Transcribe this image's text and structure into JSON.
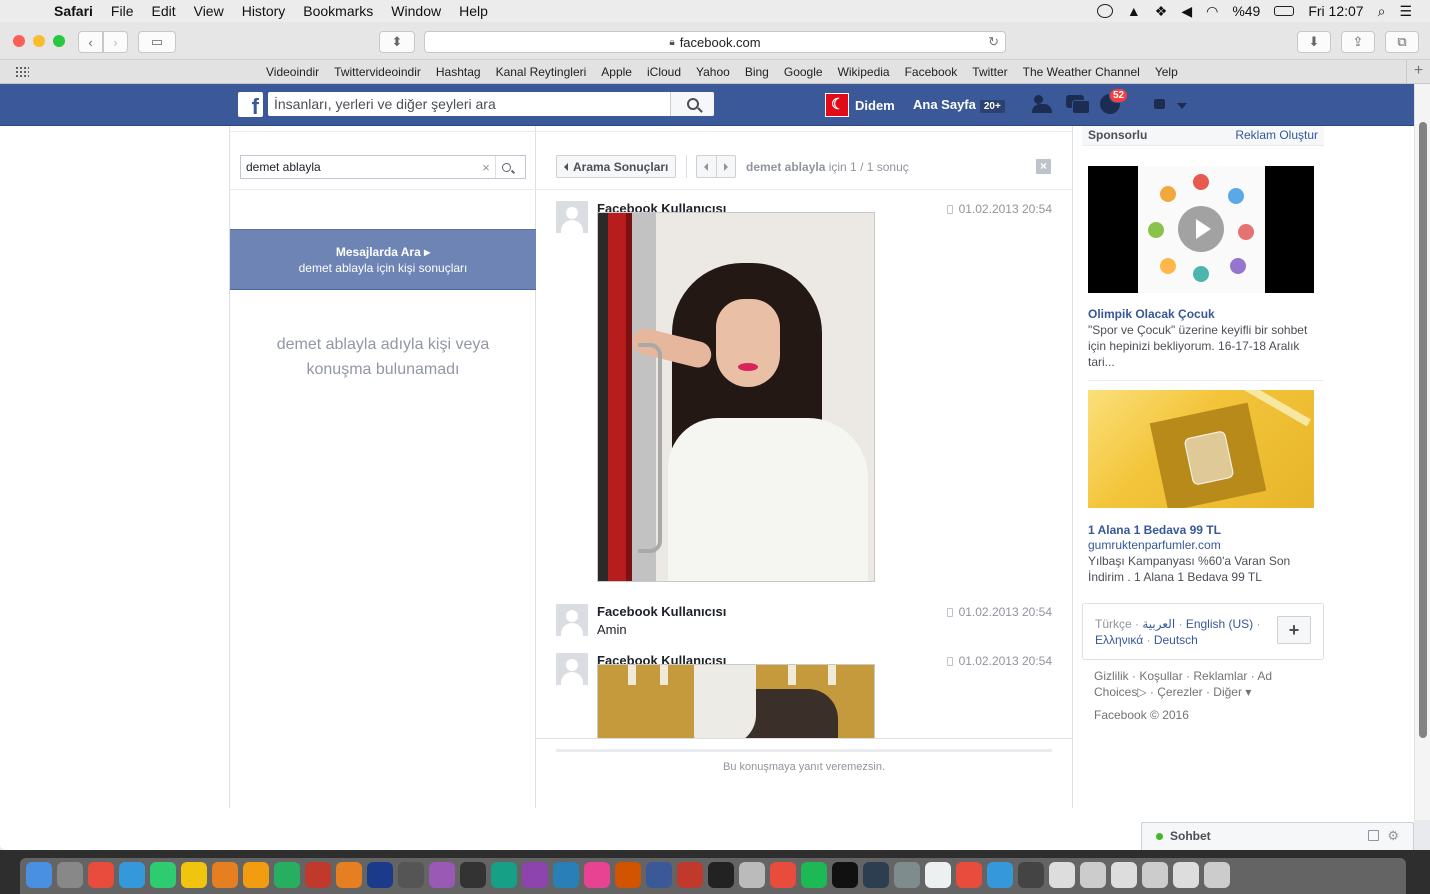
{
  "menubar": {
    "app": "Safari",
    "menus": [
      "File",
      "Edit",
      "View",
      "History",
      "Bookmarks",
      "Window",
      "Help"
    ],
    "battery": "%49",
    "clock": "Fri 12:07"
  },
  "toolbar": {
    "url": "facebook.com"
  },
  "favorites": [
    "Videoindir",
    "Twittervideoindir",
    "Hashtag",
    "Kanal Reytingleri",
    "Apple",
    "iCloud",
    "Yahoo",
    "Bing",
    "Google",
    "Wikipedia",
    "Facebook",
    "Twitter",
    "The Weather Channel",
    "Yelp"
  ],
  "fbbar": {
    "search_placeholder": "İnsanları, yerleri ve diğer şeyleri ara",
    "user_name": "Didem",
    "home_label": "Ana Sayfa",
    "home_count": "20+",
    "notif_count": "52"
  },
  "left": {
    "search_value": "demet ablayla",
    "search_messages_title": "Mesajlarda Ara",
    "search_messages_sub": "demet ablayla için kişi sonuçları",
    "not_found": "demet ablayla adıyla kişi veya konuşma bulunamadı"
  },
  "center": {
    "back_label": "Arama Sonuçları",
    "result_query": "demet ablayla",
    "result_suffix": "için 1 / 1 sonuç",
    "messages": [
      {
        "name": "Facebook Kullanıcısı",
        "time": "01.02.2013 20:54",
        "text": ""
      },
      {
        "name": "Facebook Kullanıcısı",
        "time": "01.02.2013 20:54",
        "text": "Amin"
      },
      {
        "name": "Facebook Kullanıcısı",
        "time": "01.02.2013 20:54",
        "text": ""
      }
    ],
    "reply_disabled": "Bu konuşmaya yanıt veremezsin."
  },
  "right": {
    "sponsored_label": "Sponsorlu",
    "create_ad": "Reklam Oluştur",
    "ads": [
      {
        "title": "Olimpik Olacak Çocuk",
        "domain": "",
        "desc": "\"Spor ve Çocuk\" üzerine keyifli bir sohbet için hepinizi bekliyorum. 16-17-18 Aralık tari..."
      },
      {
        "title": "1 Alana 1 Bedava 99 TL",
        "domain": "gumruktenparfumler.com",
        "desc": "Yılbaşı Kampanyası %60'a Varan Son İndirim . 1 Alana 1 Bedava 99 TL"
      }
    ],
    "languages": {
      "current": "Türkçe",
      "others": [
        "العربية",
        "English (US)",
        "Ελληνικά",
        "Deutsch"
      ]
    },
    "footer_links": [
      "Gizlilik",
      "Koşullar",
      "Reklamlar",
      "Ad Choices",
      "Çerezler",
      "Diğer"
    ],
    "copyright": "Facebook © 2016"
  },
  "chat": {
    "label": "Sohbet"
  }
}
